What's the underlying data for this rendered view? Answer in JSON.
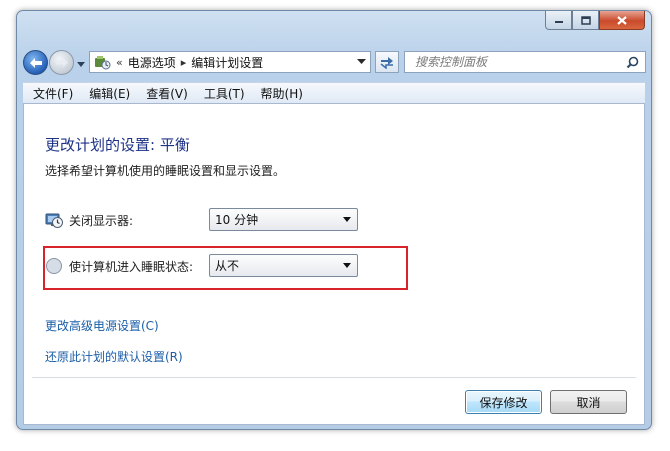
{
  "window": {
    "caption_buttons": [
      "minimize-icon",
      "maximize-icon",
      "close-icon"
    ]
  },
  "address_bar": {
    "overflow": "«",
    "breadcrumb": [
      "电源选项",
      "编辑计划设置"
    ],
    "separator": "▸"
  },
  "search": {
    "placeholder": "搜索控制面板"
  },
  "menu": {
    "items": [
      "文件(F)",
      "编辑(E)",
      "查看(V)",
      "工具(T)",
      "帮助(H)"
    ]
  },
  "content": {
    "title": "更改计划的设置: 平衡",
    "subtitle": "选择希望计算机使用的睡眠设置和显示设置。",
    "settings": [
      {
        "label": "关闭显示器:",
        "value": "10 分钟",
        "icon": "display-clock-icon"
      },
      {
        "label": "使计算机进入睡眠状态:",
        "value": "从不",
        "icon": "moon-sleep-icon"
      }
    ],
    "links": [
      "更改高级电源设置(C)",
      "还原此计划的默认设置(R)"
    ]
  },
  "buttons": {
    "save": "保存修改",
    "cancel": "取消"
  },
  "colors": {
    "title": "#1e3287",
    "link": "#1a5ea8",
    "highlight_border": "#d9232a",
    "frame": "#b9d1ea"
  }
}
